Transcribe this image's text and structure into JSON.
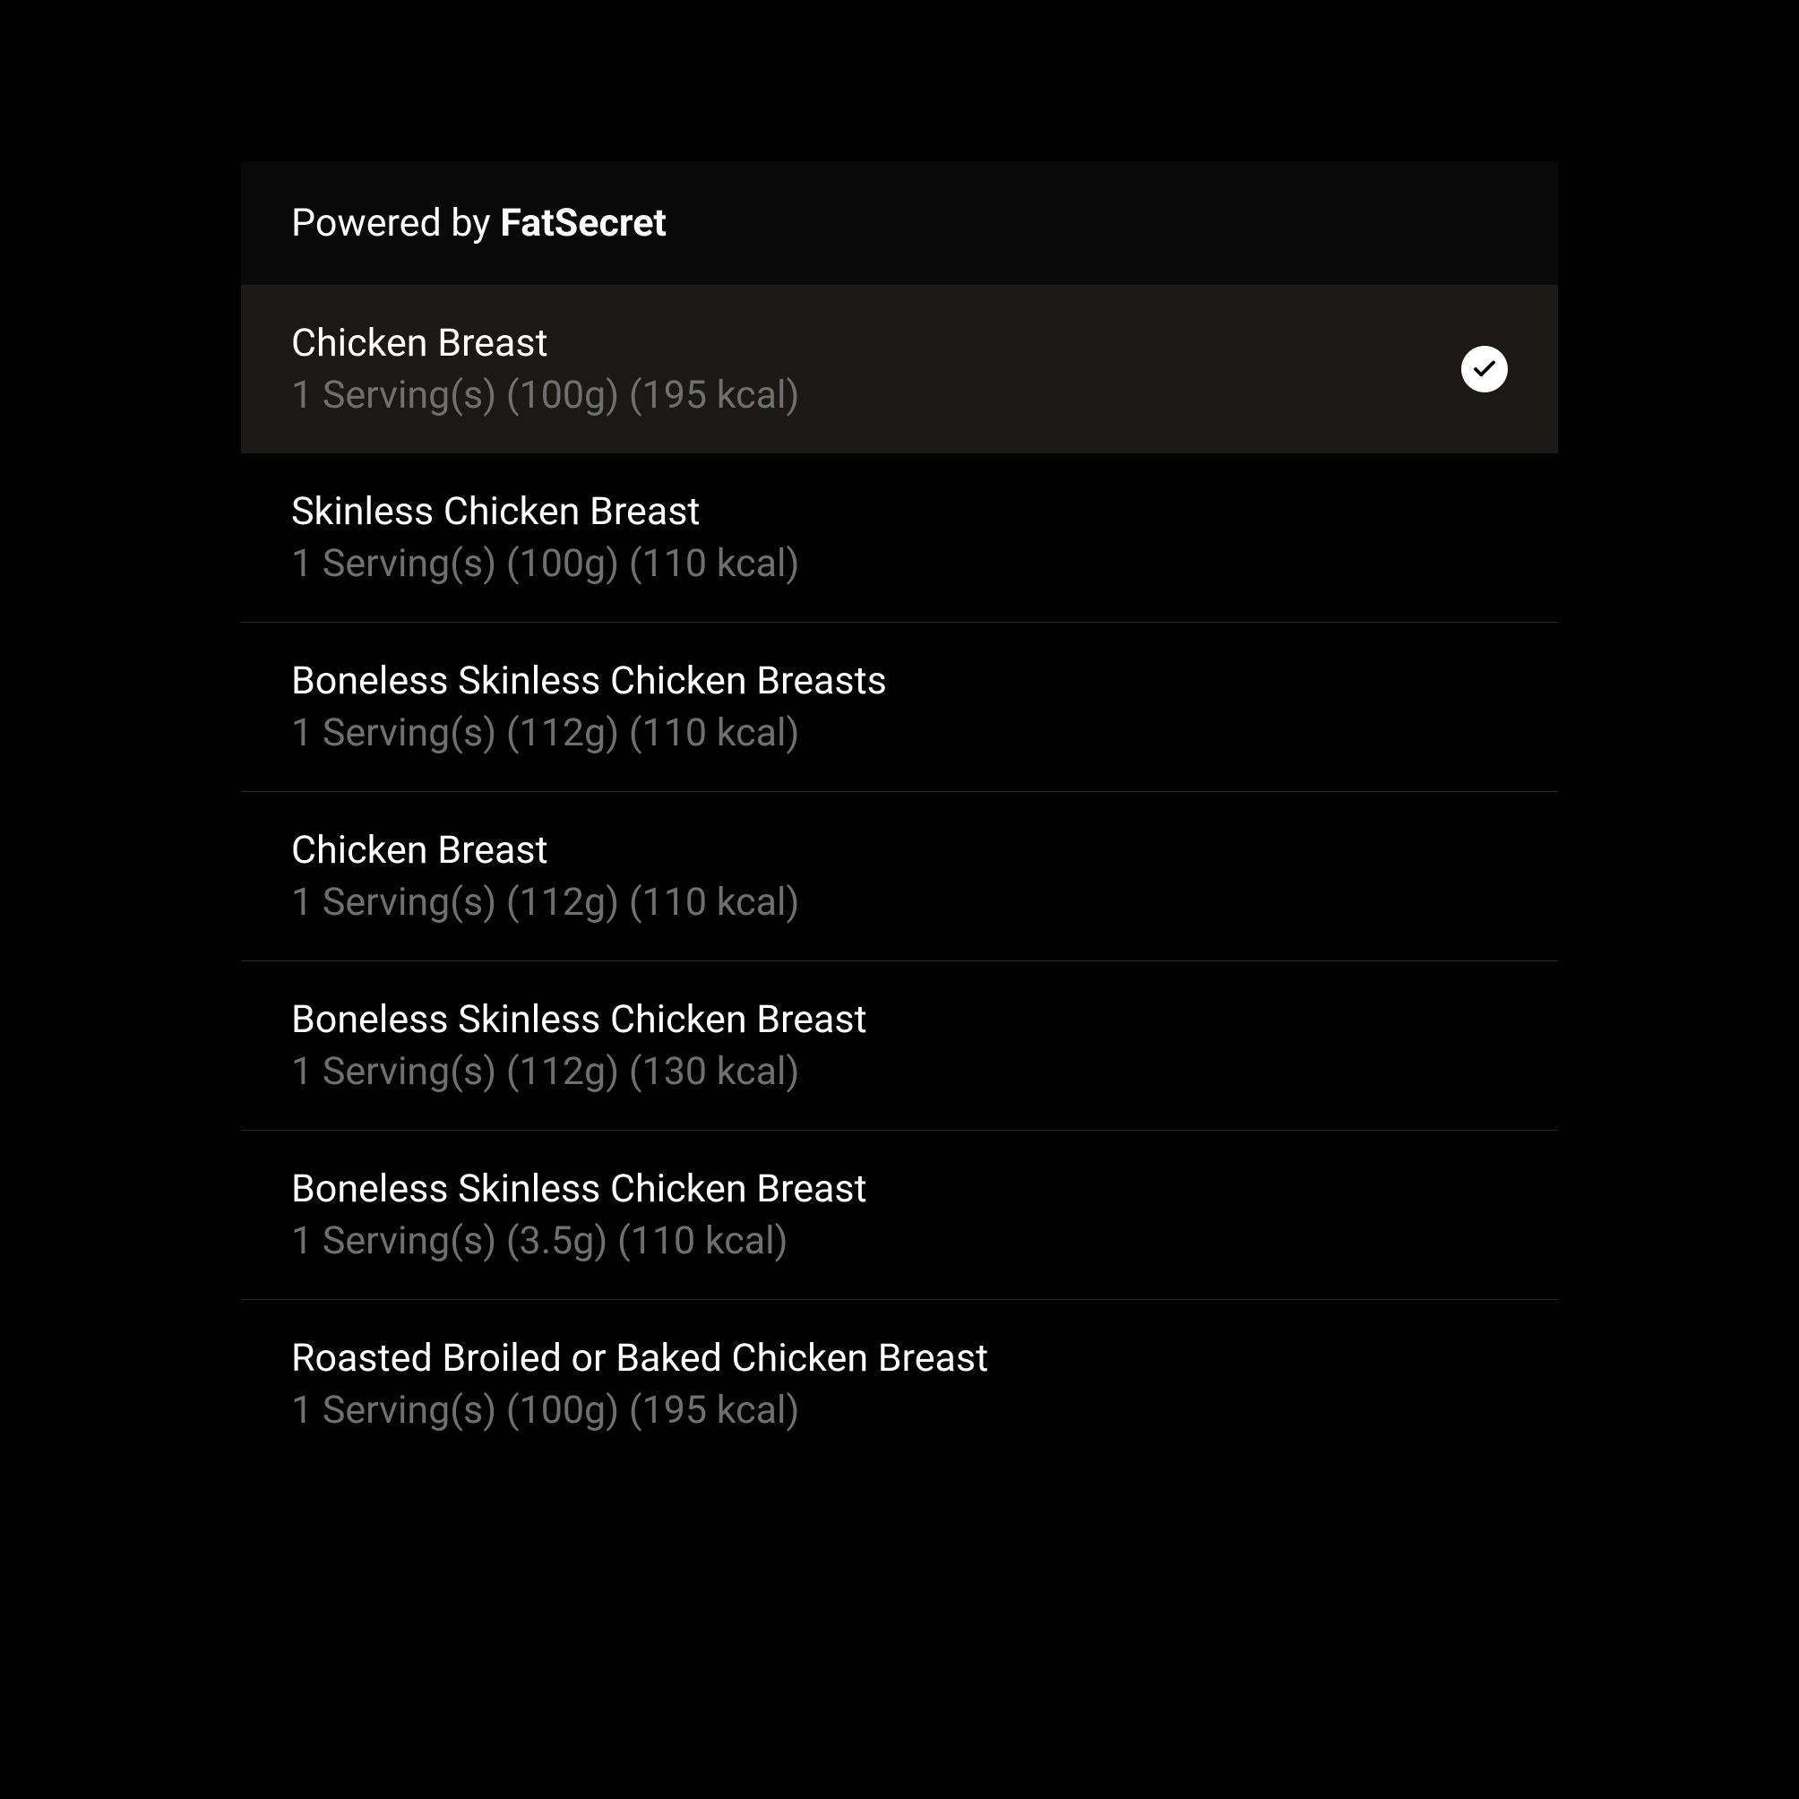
{
  "header": {
    "prefix": "Powered by ",
    "brand": "FatSecret"
  },
  "items": [
    {
      "title": "Chicken Breast",
      "subtitle": "1 Serving(s) (100g) (195 kcal)",
      "selected": true
    },
    {
      "title": "Skinless Chicken Breast",
      "subtitle": "1 Serving(s) (100g) (110 kcal)",
      "selected": false
    },
    {
      "title": "Boneless Skinless Chicken Breasts",
      "subtitle": "1 Serving(s) (112g) (110 kcal)",
      "selected": false
    },
    {
      "title": "Chicken Breast",
      "subtitle": "1 Serving(s) (112g) (110 kcal)",
      "selected": false
    },
    {
      "title": "Boneless Skinless Chicken Breast",
      "subtitle": "1 Serving(s) (112g) (130 kcal)",
      "selected": false
    },
    {
      "title": "Boneless Skinless Chicken Breast",
      "subtitle": "1 Serving(s) (3.5g) (110 kcal)",
      "selected": false
    },
    {
      "title": "Roasted Broiled or Baked Chicken Breast",
      "subtitle": "1 Serving(s) (100g) (195 kcal)",
      "selected": false
    }
  ]
}
